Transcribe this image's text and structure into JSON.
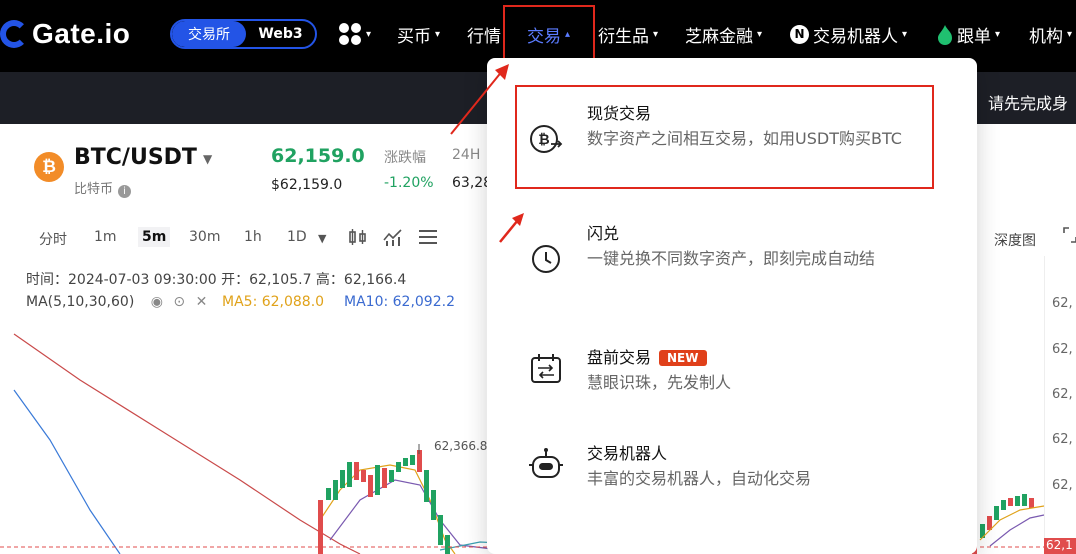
{
  "nav": {
    "brand": "Gate.io",
    "exchange_tab": "交易所",
    "web3_tab": "Web3",
    "items": [
      {
        "label": "买币",
        "caret": "▾"
      },
      {
        "label": "行情",
        "caret": ""
      },
      {
        "label": "交易",
        "caret": "▴"
      },
      {
        "label": "衍生品",
        "caret": "▾"
      },
      {
        "label": "芝麻金融",
        "caret": "▾"
      },
      {
        "label": "交易机器人",
        "caret": "▾"
      },
      {
        "label": "跟单",
        "caret": "▾"
      },
      {
        "label": "机构",
        "caret": "▾"
      }
    ],
    "grid_caret": "▾",
    "robot_glyph": "N"
  },
  "banner": {
    "text": "请先完成身"
  },
  "pair": {
    "symbol": "BTC/USDT",
    "name": "比特币",
    "price": "62,159.0",
    "price_usd": "$62,159.0",
    "change_label": "涨跌幅",
    "change_value": "-1.20%",
    "high_label": "24H",
    "high_value": "63,28"
  },
  "toolbar": {
    "timeframes": [
      "分时",
      "1m",
      "5m",
      "30m",
      "1h",
      "1D"
    ],
    "selected": "5m",
    "depth_label": "深度图"
  },
  "chart_info": {
    "ohlc": "时间：2024-07-03 09:30:00    开：62,105.7    高：62,166.4",
    "ma_label": "MA(5,10,30,60)",
    "ma5": "MA5: 62,088.0",
    "ma10": "MA10: 62,092.2",
    "peak": "62,366.8",
    "current": "62,1"
  },
  "y_ticks": [
    "62,",
    "62,",
    "62,",
    "62,",
    "62,"
  ],
  "dropdown": {
    "items": [
      {
        "title": "现货交易",
        "desc": "数字资产之间相互交易，如用USDT购买BTC"
      },
      {
        "title": "闪兑",
        "desc": "一键兑换不同数字资产，即刻完成自动结"
      },
      {
        "title": "盘前交易",
        "badge": "NEW",
        "desc": "慧眼识珠，先发制人"
      },
      {
        "title": "交易机器人",
        "desc": "丰富的交易机器人，自动化交易"
      }
    ]
  },
  "colors": {
    "brand": "#2354e6",
    "up": "#20a261",
    "down": "#e04c4c",
    "highlight": "#e0281c",
    "nav_active": "#5b7cff"
  }
}
